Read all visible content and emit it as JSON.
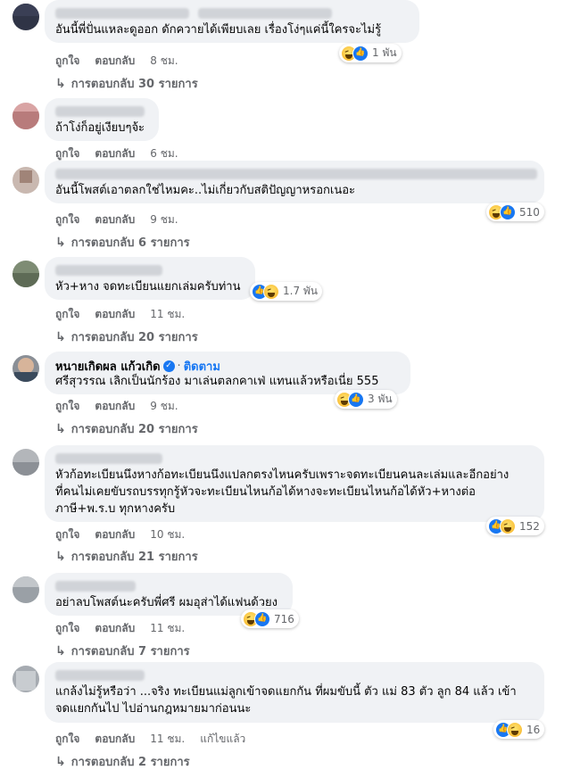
{
  "actions": {
    "like": "ถูกใจ",
    "reply": "ตอบกลับ",
    "edited": "แก้ไขแล้ว"
  },
  "reply_arrow": "↳",
  "comments": [
    {
      "text": "อันนี้พี่ปั่นแหละดูออก ดักควายได้เพียบเลย เรื่องโง่ๆแค่นี้ใครจะไม่รู้",
      "time": "8 ชม.",
      "reactions": [
        "haha",
        "like"
      ],
      "count": "1 พัน",
      "replies": "การตอบกลับ 30 รายการ"
    },
    {
      "text": "ถ้าโง่ก็อยู่เงียบๆจ้ะ",
      "time": "6 ชม.",
      "reactions": [],
      "count": "",
      "replies": ""
    },
    {
      "text": "อันนี้โพสต์เอาตลกใช่ไหมคะ..ไม่เกี่ยวกับสติปัญญาหรอกเนอะ",
      "time": "9 ชม.",
      "reactions": [
        "haha",
        "like"
      ],
      "count": "510",
      "replies": "การตอบกลับ 6 รายการ"
    },
    {
      "text": "หัว+หาง จดทะเบียนแยกเล่มครับท่าน",
      "time": "11 ชม.",
      "reactions": [
        "like",
        "haha"
      ],
      "count": "1.7 พัน",
      "replies": "การตอบกลับ 20 รายการ"
    },
    {
      "name": "หนายเกิดผล แก้วเกิด",
      "follow": "ติดตาม",
      "text": "ศรีสุวรรณ เลิกเป็นนักร้อง มาเล่นตลกคาเฟ่ แทนแล้วหรือเนี่ย 555",
      "time": "9 ชม.",
      "reactions": [
        "haha",
        "like"
      ],
      "count": "3 พัน",
      "replies": "การตอบกลับ 20 รายการ"
    },
    {
      "text_lines": [
        "หัวก้อทะเบียนนึงหางก้อทะเบียนนึงแปลกตรงไหนครับเพราะจดทะเบียนคนละเล่มและอีกอย่าง",
        "ที่คนไม่เคยขับรถบรรทุกรู้หัวจะทะเบียนไหนก้อได้หางจะทะเบียนไหนก้อได้หัว+หางต่อ",
        "ภาษี+พ.ร.บ ทุกหางครับ"
      ],
      "time": "10 ชม.",
      "reactions": [
        "like",
        "haha"
      ],
      "count": "152",
      "replies": "การตอบกลับ 21 รายการ"
    },
    {
      "text": "อย่าลบโพสต์นะครับพี่ศรี ผมอุส่าได้แฟนด้วยง",
      "time": "11 ชม.",
      "reactions": [
        "haha",
        "like"
      ],
      "count": "716",
      "replies": "การตอบกลับ 7 รายการ"
    },
    {
      "text_lines": [
        "แกล้งไม่รู้หรือว่า ...จริง ทะเบียนแม่ลูกเข้าจดแยกกัน ที่ผมขับนี้ ตัว แม่ 83 ตัว ลูก 84 แล้ว เข้า",
        "จดแยกกันไป ไปอ่านกฎหมายมาก่อนนะ"
      ],
      "time": "11 ชม.",
      "edited": true,
      "reactions": [
        "like",
        "haha"
      ],
      "count": "16",
      "replies": "การตอบกลับ 2 รายการ"
    }
  ]
}
